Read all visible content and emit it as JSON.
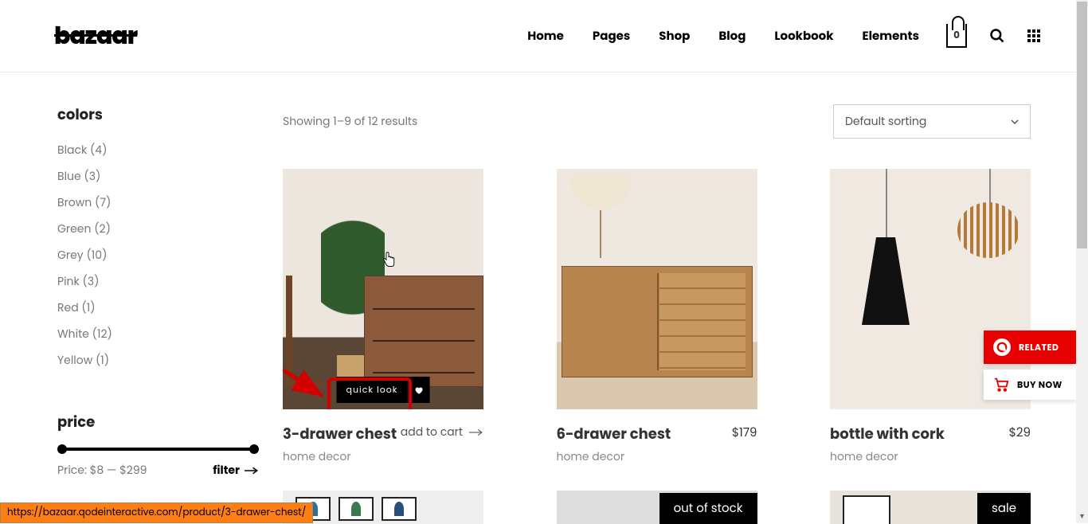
{
  "brand": "bazaar",
  "nav": [
    "Home",
    "Pages",
    "Shop",
    "Blog",
    "Lookbook",
    "Elements"
  ],
  "cart_count": "0",
  "sidebar": {
    "colors_title": "colors",
    "colors": [
      {
        "label": "Black",
        "count": "(4)"
      },
      {
        "label": "Blue",
        "count": "(3)"
      },
      {
        "label": "Brown",
        "count": "(7)"
      },
      {
        "label": "Green",
        "count": "(2)"
      },
      {
        "label": "Grey",
        "count": "(10)"
      },
      {
        "label": "Pink",
        "count": "(3)"
      },
      {
        "label": "Red",
        "count": "(1)"
      },
      {
        "label": "White",
        "count": "(12)"
      },
      {
        "label": "Yellow",
        "count": "(1)"
      }
    ],
    "price_title": "price",
    "price_line": "Price: $8 — $299",
    "filter_label": "filter"
  },
  "results_text": "Showing 1–9 of 12 results",
  "sort_label": "Default sorting",
  "quick_look": "quick look",
  "products": [
    {
      "name": "3-drawer chest",
      "cat": "home decor",
      "action": "add to cart"
    },
    {
      "name": "6-drawer chest",
      "cat": "home decor",
      "price": "$179"
    },
    {
      "name": "bottle with cork",
      "cat": "home decor",
      "price": "$29"
    }
  ],
  "badges": {
    "out": "out of stock",
    "sale": "sale"
  },
  "float": {
    "related": "RELATED",
    "buy": "BUY NOW"
  },
  "status_url": "https://bazaar.qodeinteractive.com/product/3-drawer-chest/"
}
